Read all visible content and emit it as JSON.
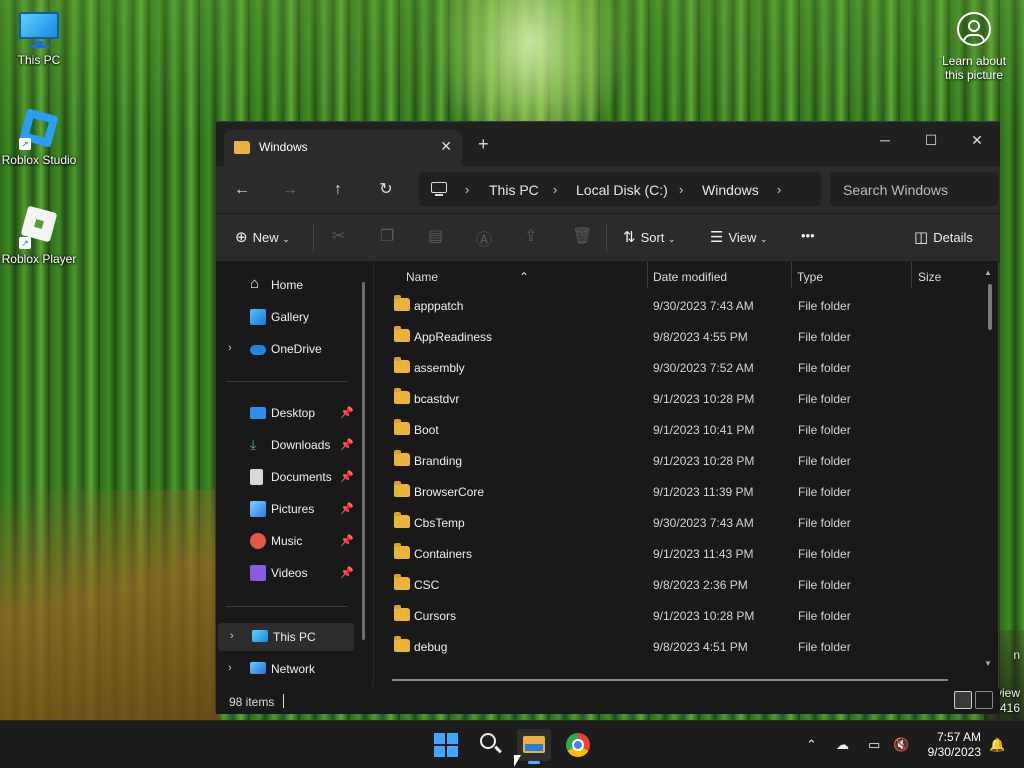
{
  "desktop": {
    "icons": [
      {
        "label": "This PC"
      },
      {
        "label": "Roblox Studio"
      },
      {
        "label": "Roblox Player"
      }
    ],
    "learn_label": "Learn about this picture",
    "edge_texts": [
      "n",
      "view",
      "416"
    ]
  },
  "window": {
    "tab_title": "Windows",
    "controls": {
      "minimize": "─",
      "maximize": "☐",
      "close": "✕"
    },
    "new_tab": "+",
    "breadcrumbs": [
      "This PC",
      "Local Disk (C:)",
      "Windows"
    ],
    "search_placeholder": "Search Windows",
    "commands": {
      "new": "New",
      "sort": "Sort",
      "view": "View",
      "more": "•••",
      "details": "Details"
    },
    "nav": {
      "top": [
        {
          "label": "Home"
        },
        {
          "label": "Gallery"
        },
        {
          "label": "OneDrive"
        }
      ],
      "pinned": [
        {
          "label": "Desktop"
        },
        {
          "label": "Downloads"
        },
        {
          "label": "Documents"
        },
        {
          "label": "Pictures"
        },
        {
          "label": "Music"
        },
        {
          "label": "Videos"
        }
      ],
      "bottom": [
        {
          "label": "This PC"
        },
        {
          "label": "Network"
        }
      ]
    },
    "columns": {
      "name": "Name",
      "date": "Date modified",
      "type": "Type",
      "size": "Size"
    },
    "files": [
      {
        "name": "apppatch",
        "date": "9/30/2023 7:43 AM",
        "type": "File folder"
      },
      {
        "name": "AppReadiness",
        "date": "9/8/2023 4:55 PM",
        "type": "File folder"
      },
      {
        "name": "assembly",
        "date": "9/30/2023 7:52 AM",
        "type": "File folder"
      },
      {
        "name": "bcastdvr",
        "date": "9/1/2023 10:28 PM",
        "type": "File folder"
      },
      {
        "name": "Boot",
        "date": "9/1/2023 10:41 PM",
        "type": "File folder"
      },
      {
        "name": "Branding",
        "date": "9/1/2023 10:28 PM",
        "type": "File folder"
      },
      {
        "name": "BrowserCore",
        "date": "9/1/2023 11:39 PM",
        "type": "File folder"
      },
      {
        "name": "CbsTemp",
        "date": "9/30/2023 7:43 AM",
        "type": "File folder"
      },
      {
        "name": "Containers",
        "date": "9/1/2023 11:43 PM",
        "type": "File folder"
      },
      {
        "name": "CSC",
        "date": "9/8/2023 2:36 PM",
        "type": "File folder"
      },
      {
        "name": "Cursors",
        "date": "9/1/2023 10:28 PM",
        "type": "File folder"
      },
      {
        "name": "debug",
        "date": "9/8/2023 4:51 PM",
        "type": "File folder"
      }
    ],
    "status": "98 items"
  },
  "taskbar": {
    "time": "7:57 AM",
    "date": "9/30/2023"
  }
}
